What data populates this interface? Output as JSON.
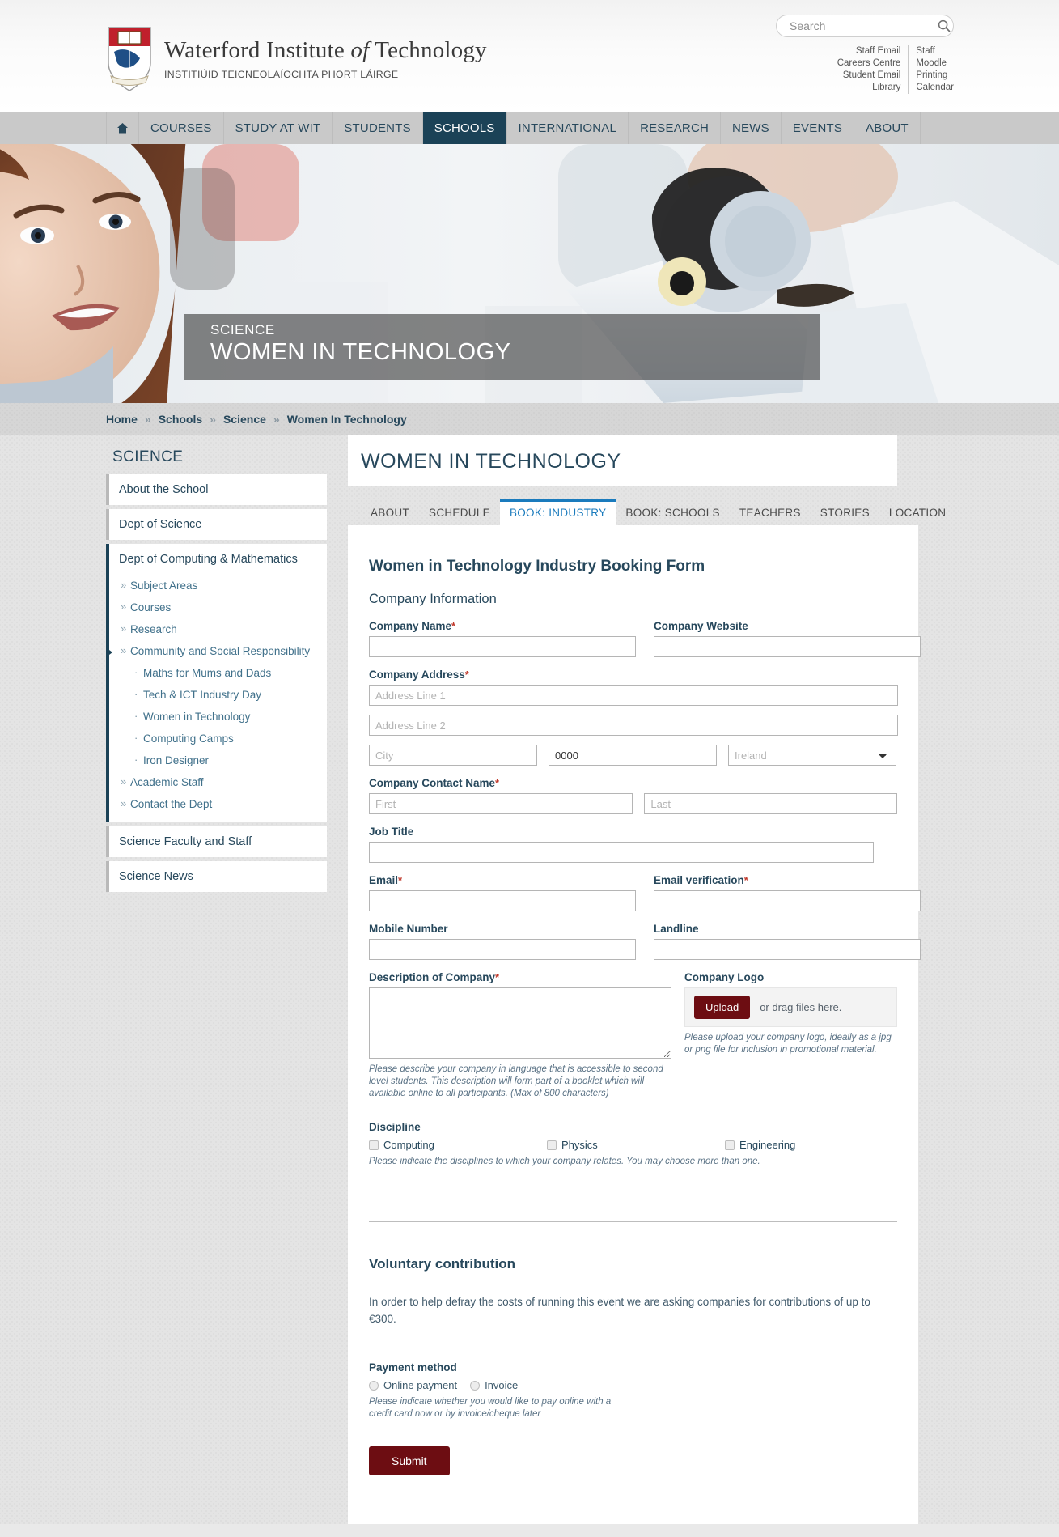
{
  "header": {
    "logo_title_part1": "Waterford Institute ",
    "logo_title_em": "of",
    "logo_title_part2": " Technology",
    "logo_subtitle": "INSTITIÚID TEICNEOLAÍOCHTA PHORT LÁIRGE",
    "search_placeholder": "Search",
    "search_value": "",
    "quick_links_left": [
      "Staff Email",
      "Careers Centre",
      "Student Email",
      "Library"
    ],
    "quick_links_right": [
      "Staff",
      "Moodle",
      "Printing",
      "Calendar"
    ]
  },
  "nav": {
    "home_icon": "home-icon",
    "items": [
      {
        "label": "COURSES",
        "active": false
      },
      {
        "label": "STUDY AT WIT",
        "active": false
      },
      {
        "label": "STUDENTS",
        "active": false
      },
      {
        "label": "SCHOOLS",
        "active": true
      },
      {
        "label": "INTERNATIONAL",
        "active": false
      },
      {
        "label": "RESEARCH",
        "active": false
      },
      {
        "label": "NEWS",
        "active": false
      },
      {
        "label": "EVENTS",
        "active": false
      },
      {
        "label": "ABOUT",
        "active": false
      }
    ]
  },
  "hero": {
    "kicker": "SCIENCE",
    "title": "WOMEN IN TECHNOLOGY"
  },
  "breadcrumb": {
    "separator": "»",
    "items": [
      "Home",
      "Schools",
      "Science",
      "Women In Technology"
    ]
  },
  "sidebar": {
    "heading": "SCIENCE",
    "blocks": [
      {
        "label": "About the School",
        "open": false,
        "children": []
      },
      {
        "label": "Dept of Science",
        "open": false,
        "children": []
      },
      {
        "label": "Dept of Computing & Mathematics",
        "open": true,
        "children": [
          {
            "label": "Subject Areas",
            "level": 1,
            "marker": "»",
            "arrow": false
          },
          {
            "label": "Courses",
            "level": 1,
            "marker": "»",
            "arrow": false
          },
          {
            "label": "Research",
            "level": 1,
            "marker": "»",
            "arrow": false
          },
          {
            "label": "Community and Social Responsibility",
            "level": 1,
            "marker": "»",
            "arrow": true
          },
          {
            "label": "Maths for Mums and Dads",
            "level": 2,
            "marker": "·",
            "arrow": false
          },
          {
            "label": "Tech & ICT Industry Day",
            "level": 2,
            "marker": "·",
            "arrow": false
          },
          {
            "label": "Women in Technology",
            "level": 2,
            "marker": "·",
            "arrow": false
          },
          {
            "label": "Computing Camps",
            "level": 2,
            "marker": "·",
            "arrow": false
          },
          {
            "label": "Iron Designer",
            "level": 2,
            "marker": "·",
            "arrow": false
          },
          {
            "label": "Academic Staff",
            "level": 1,
            "marker": "»",
            "arrow": false
          },
          {
            "label": "Contact the Dept",
            "level": 1,
            "marker": "»",
            "arrow": false
          }
        ]
      },
      {
        "label": "Science Faculty and Staff",
        "open": false,
        "children": []
      },
      {
        "label": "Science News",
        "open": false,
        "children": []
      }
    ]
  },
  "main": {
    "title": "WOMEN IN TECHNOLOGY",
    "tabs": [
      {
        "label": "ABOUT",
        "active": false
      },
      {
        "label": "SCHEDULE",
        "active": false
      },
      {
        "label": "BOOK: INDUSTRY",
        "active": true
      },
      {
        "label": "BOOK: SCHOOLS",
        "active": false
      },
      {
        "label": "TEACHERS",
        "active": false
      },
      {
        "label": "STORIES",
        "active": false
      },
      {
        "label": "LOCATION",
        "active": false
      }
    ]
  },
  "form": {
    "title": "Women in Technology Industry Booking Form",
    "section_company": "Company Information",
    "company_name_label": "Company Name",
    "company_name_required": "*",
    "company_name_value": "",
    "company_website_label": "Company Website",
    "company_website_value": "",
    "company_address_label": "Company Address",
    "company_address_required": "*",
    "address_line1_placeholder": "Address Line 1",
    "address_line1_value": "",
    "address_line2_placeholder": "Address Line 2",
    "address_line2_value": "",
    "city_placeholder": "City",
    "city_value": "",
    "zip_placeholder": "0000",
    "zip_value": "0000",
    "country_selected": "Ireland",
    "country_options": [
      "Ireland"
    ],
    "contact_name_label": "Company Contact Name",
    "contact_name_required": "*",
    "first_placeholder": "First",
    "first_value": "",
    "last_placeholder": "Last",
    "last_value": "",
    "job_title_label": "Job Title",
    "job_title_value": "",
    "email_label": "Email",
    "email_required": "*",
    "email_value": "",
    "email_verification_label": "Email verification",
    "email_verification_required": "*",
    "email_verification_value": "",
    "mobile_label": "Mobile Number",
    "mobile_value": "",
    "landline_label": "Landline",
    "landline_value": "",
    "description_label": "Description of Company",
    "description_required": "*",
    "description_value": "",
    "description_hint": "Please describe your company in language that is accessible to second level students. This description will form part of a booklet which will available online to all participants. (Max of 800 characters)",
    "logo_label": "Company Logo",
    "upload_button": "Upload",
    "upload_text": "or drag files here.",
    "logo_hint": "Please upload your company logo, ideally as a jpg or png file for inclusion in promotional material.",
    "discipline_label": "Discipline",
    "discipline_options": [
      "Computing",
      "Physics",
      "Engineering"
    ],
    "discipline_hint": "Please indicate the disciplines to which your company relates. You may choose more than one.",
    "voluntary_title": "Voluntary contribution",
    "voluntary_text": "In order to help defray the costs of running this event we are asking companies for contributions of up to €300.",
    "payment_label": "Payment method",
    "payment_options": [
      "Online payment",
      "Invoice"
    ],
    "payment_hint": "Please indicate whether you would like to pay online with a credit card now or by invoice/cheque later",
    "submit_label": "Submit"
  },
  "colors": {
    "brand_dark": "#1b4257",
    "accent_blue": "#1a7bbd",
    "button_maroon": "#6d0d12",
    "required_red": "#c0392b"
  }
}
